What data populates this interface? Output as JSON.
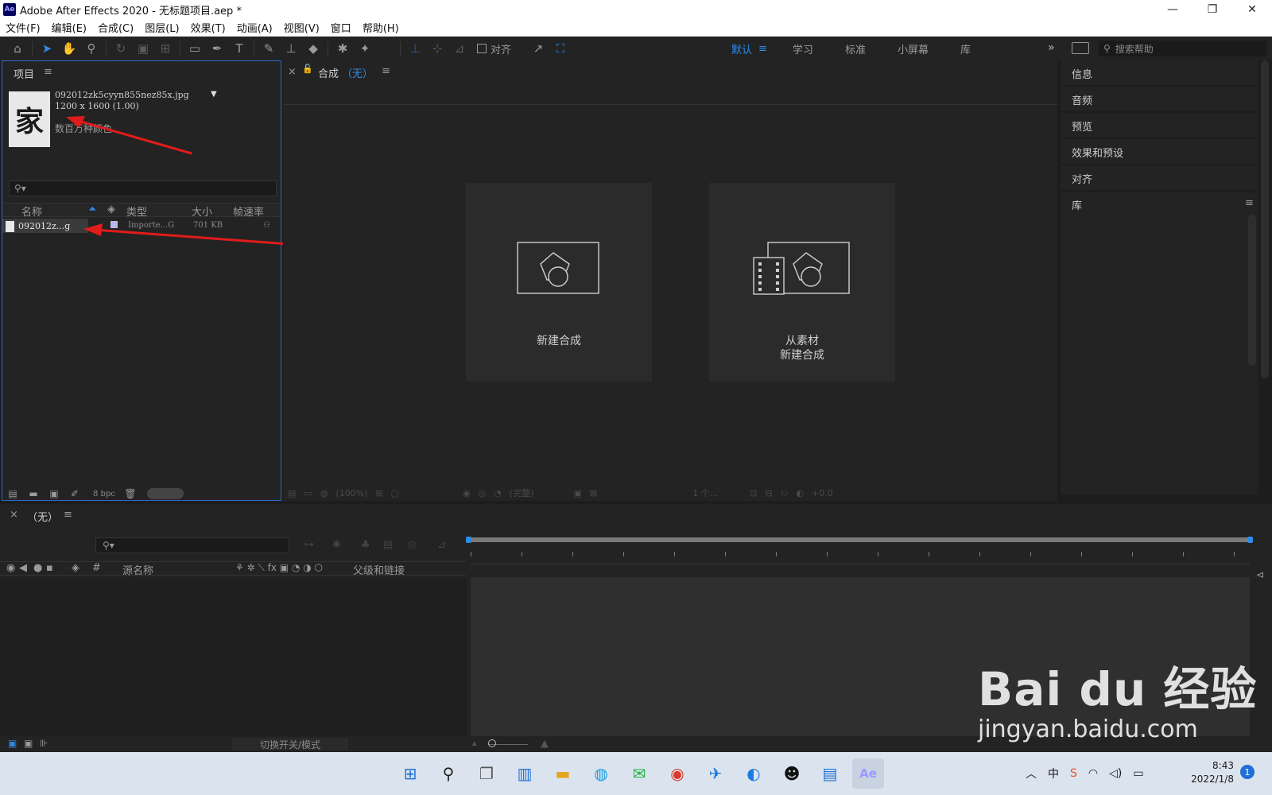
{
  "window": {
    "app_badge": "Ae",
    "title": "Adobe After Effects 2020 - 无标题项目.aep *",
    "controls": [
      "—",
      "❐",
      "✕"
    ]
  },
  "menu": [
    "文件(F)",
    "编辑(E)",
    "合成(C)",
    "图层(L)",
    "效果(T)",
    "动画(A)",
    "视图(V)",
    "窗口",
    "帮助(H)"
  ],
  "toolbar": {
    "align_label": "对齐",
    "workspaces": [
      "默认",
      "学习",
      "标准",
      "小屏幕",
      "库"
    ],
    "workspace_menu": "≡",
    "more": "»",
    "search_placeholder": "搜索帮助"
  },
  "project": {
    "tab": "项目",
    "menu": "≡",
    "thumb_char": "家",
    "asset_name": "092012zk5cyyn855nez85x.jpg",
    "asset_dims": "1200 x 1600 (1.00)",
    "asset_colors": "数百万种颜色",
    "columns": [
      "名称",
      "类型",
      "大小",
      "帧速率"
    ],
    "row": {
      "name": "092012z...g",
      "type": "Importe...G",
      "size": "701 KB"
    },
    "bpc": "8 bpc"
  },
  "comp": {
    "close": "×",
    "tab": "合成",
    "tab_value": "（无）",
    "menu": "≡",
    "new_comp": "新建合成",
    "from_footage_1": "从素材",
    "from_footage_2": "新建合成",
    "footer_zoom": "(100%)",
    "footer_quality": "(完整)",
    "footer_view": "1 个...",
    "footer_exposure": "+0.0"
  },
  "right_panels": [
    "信息",
    "音频",
    "预览",
    "效果和预设",
    "对齐"
  ],
  "library": {
    "label": "库",
    "menu": "≡"
  },
  "timeline": {
    "close": "×",
    "tab": "（无）",
    "menu": "≡",
    "columns": [
      "#",
      "源名称",
      "父级和链接"
    ],
    "toggle_label": "切换开关/模式"
  },
  "watermark": {
    "big": "Bai du 经验",
    "small": "jingyan.baidu.com"
  },
  "taskbar": {
    "tray_lang": "中",
    "time": "8:43",
    "date": "2022/1/8",
    "notifications": "1"
  },
  "colors": {
    "accent": "#2d8ceb",
    "annotation_arrow": "#e01b1b",
    "panel_bg": "#232323"
  }
}
